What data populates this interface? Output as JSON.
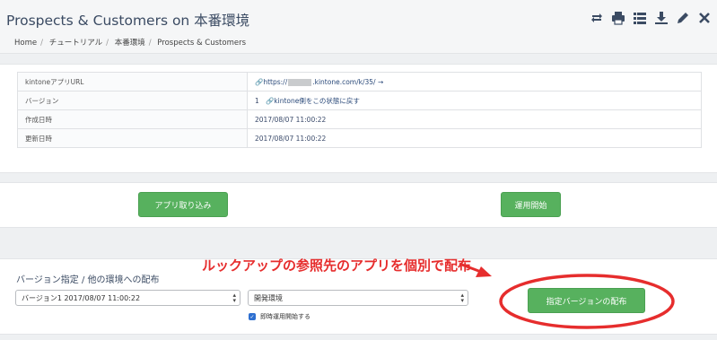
{
  "app": {
    "title": "Prospects & Customers on 本番環境",
    "breadcrumbs": [
      "Home",
      "チュートリアル",
      "本番環境",
      "Prospects & Customers"
    ]
  },
  "toolbar": {
    "icons": [
      "swap-icon",
      "print-icon",
      "list-icon",
      "download-icon",
      "pencil-icon",
      "close-icon"
    ]
  },
  "info": {
    "rows": [
      {
        "label": "kintoneアプリURL",
        "value_prefix": "https://",
        "value_suffix": ".kintone.com/k/35/ →"
      },
      {
        "label": "バージョン",
        "value": "1",
        "link": "kintone側をこの状態に戻す"
      },
      {
        "label": "作成日時",
        "value": "2017/08/07 11:00:22"
      },
      {
        "label": "更新日時",
        "value": "2017/08/07 11:00:22"
      }
    ]
  },
  "actions": {
    "import_label": "アプリ取り込み",
    "start_label": "運用開始"
  },
  "deploy": {
    "title": "バージョン指定 / 他の環境への配布",
    "version_select": "バージョン1 2017/08/07 11:00:22",
    "env_select": "開発環境",
    "checkbox_label": "即時運用開始する",
    "button_label": "指定バージョンの配布"
  },
  "annotation": {
    "text": "ルックアップの参照先のアプリを個別で配布",
    "color": "#e62d2d"
  },
  "colors": {
    "accent_green": "#57b15e",
    "title_blue": "#3b4b63"
  }
}
